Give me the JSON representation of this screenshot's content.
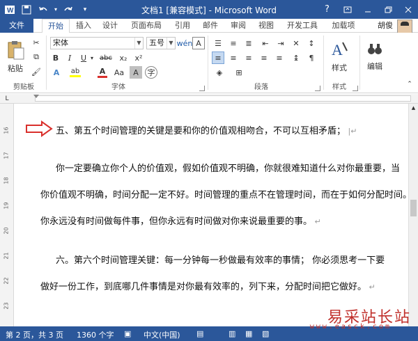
{
  "window": {
    "title": "文档1 [兼容模式] - Microsoft Word",
    "help_label": "?"
  },
  "tabs": [
    "文件",
    "开始",
    "插入",
    "设计",
    "页面布局",
    "引用",
    "邮件",
    "审阅",
    "视图",
    "开发工具",
    "加载项"
  ],
  "active_tab": "开始",
  "user": "胡俊",
  "ribbon": {
    "clipboard": {
      "paste_label": "粘贴",
      "group_label": "剪贴板"
    },
    "font": {
      "font_name": "宋体",
      "font_size": "五号",
      "group_label": "字体",
      "bold": "B",
      "italic": "I",
      "underline": "U",
      "strike": "abc",
      "sub": "x₂",
      "sup": "x²",
      "font_color_label": "A",
      "highlight_label": "ab",
      "clear_label": "A"
    },
    "paragraph": {
      "group_label": "段落"
    },
    "styles": {
      "label": "样式",
      "group_label": "样式"
    },
    "editing": {
      "label": "编辑"
    }
  },
  "document": {
    "lines": [
      "五、第五个时间管理的关键是要和你的价值观相吻合，不可以互相矛盾；",
      "你一定要确立你个人的价值观，假如价值观不明确，你就很难知道什么对你最重要，当",
      "你价值观不明确，时间分配一定不好。时间管理的重点不在管理时间，而在于如何分配时间。",
      "你永远没有时间做每件事，但你永远有时间做对你来说最重要的事。",
      "六。第六个时间管理关键：每一分钟每一秒做最有效率的事情；      你必须思考一下要",
      "做好一份工作，到底哪几件事情是对你最有效率的，列下来，分配时间把它做好。"
    ],
    "ruler_ticks": [
      "16",
      "17",
      "18",
      "19",
      "20",
      "21",
      "22",
      "23"
    ]
  },
  "status": {
    "page": "第 2 页，共 3 页",
    "words": "1360 个字",
    "language": "中文(中国)"
  },
  "watermark": {
    "cn": "易采站长站",
    "url": "www.easck.com"
  },
  "colors": {
    "accent": "#2b579a",
    "arrow": "#d9302c"
  }
}
